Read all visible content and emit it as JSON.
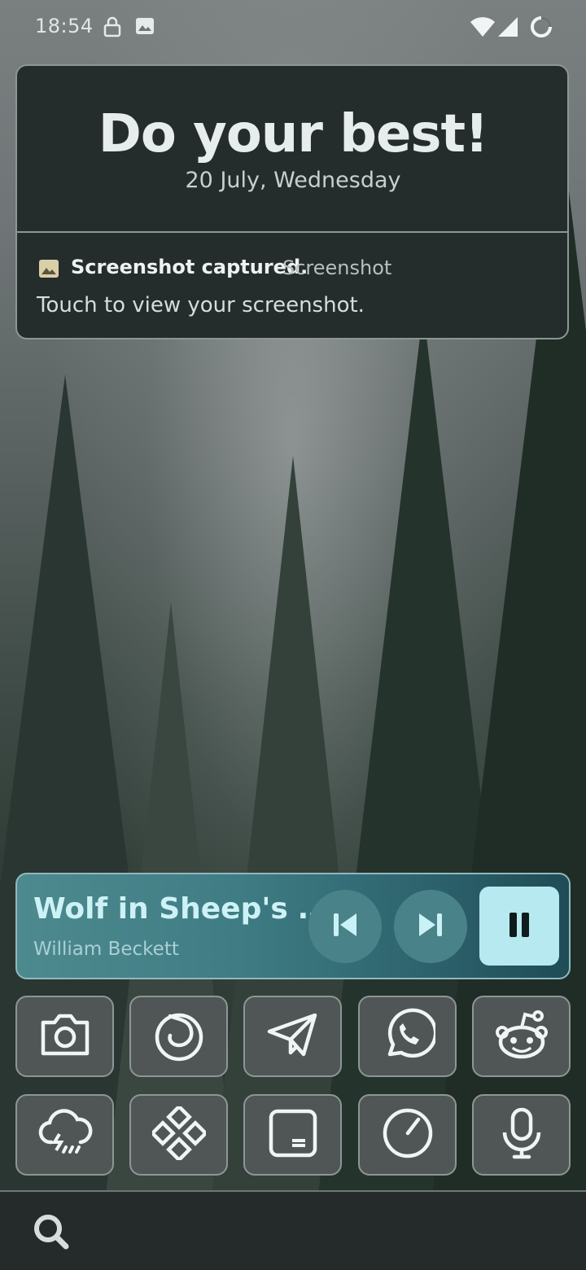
{
  "status_bar": {
    "time": "18:54",
    "icons": [
      "lock-icon",
      "image-icon",
      "wifi-icon",
      "cellular-signal-icon",
      "battery-ring-icon"
    ]
  },
  "header": {
    "headline": "Do your best!",
    "date": "20 July, Wednesday"
  },
  "notification": {
    "icon": "image-icon",
    "title": "Screenshot captured.",
    "app": "Screenshot",
    "body": "Touch to view your screenshot."
  },
  "media": {
    "title": "Wolf in Sheep's …",
    "artist": "William Beckett",
    "controls": [
      "skip-previous-icon",
      "skip-next-icon",
      "pause-icon"
    ]
  },
  "apps": [
    {
      "icon": "camera-icon"
    },
    {
      "icon": "firefox-icon"
    },
    {
      "icon": "telegram-icon"
    },
    {
      "icon": "whatsapp-icon"
    },
    {
      "icon": "reddit-icon"
    },
    {
      "icon": "weather-rain-icon"
    },
    {
      "icon": "app-grid-icon"
    },
    {
      "icon": "notes-icon"
    },
    {
      "icon": "clock-icon"
    },
    {
      "icon": "microphone-icon"
    }
  ],
  "bottom_bar": {
    "icon": "search-icon"
  },
  "colors": {
    "card_bg": "#252d2c",
    "card_border": "#8e9695",
    "media_accent": "#b7eaf0",
    "tile_bg": "#4f5655"
  }
}
